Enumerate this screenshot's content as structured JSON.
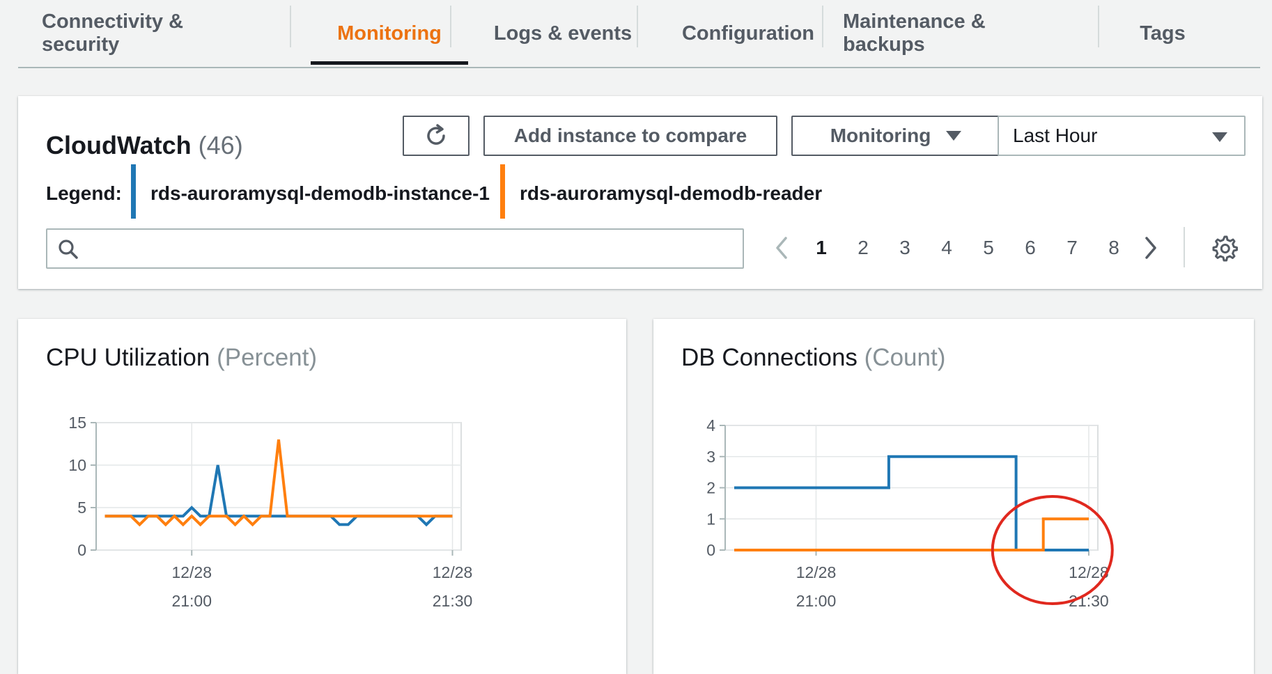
{
  "tabs": [
    {
      "label": "Connectivity & security",
      "active": false
    },
    {
      "label": "Monitoring",
      "active": true
    },
    {
      "label": "Logs & events",
      "active": false
    },
    {
      "label": "Configuration",
      "active": false
    },
    {
      "label": "Maintenance & backups",
      "active": false
    },
    {
      "label": "Tags",
      "active": false
    }
  ],
  "cloudwatch": {
    "title": "CloudWatch",
    "count": "(46)",
    "refresh_icon": "refresh-icon",
    "add_compare_label": "Add instance to compare",
    "monitoring_dropdown": "Monitoring",
    "time_range": "Last Hour",
    "legend_label": "Legend:",
    "legend": [
      {
        "name": "rds-auroramysql-demodb-instance-1",
        "color": "#1f77b4"
      },
      {
        "name": "rds-auroramysql-demodb-reader",
        "color": "#ff7f0e"
      }
    ],
    "search": {
      "value": "",
      "placeholder": ""
    },
    "pagination": {
      "pages": [
        "1",
        "2",
        "3",
        "4",
        "5",
        "6",
        "7",
        "8"
      ],
      "current": "1"
    }
  },
  "colors": {
    "accent": "#ec7211",
    "series1": "#1f77b4",
    "series2": "#ff7f0e",
    "annotation": "#e0281e"
  },
  "chart_data": [
    {
      "type": "line",
      "title": "CPU Utilization",
      "unit": "(Percent)",
      "xlabel": "",
      "ylabel": "",
      "ylim": [
        0,
        15
      ],
      "yticks": [
        "0",
        "5",
        "10",
        "15"
      ],
      "xlim": [
        "20:49",
        "21:31"
      ],
      "xticks": [
        {
          "at": "21:00",
          "date": "12/28",
          "time": "21:00"
        },
        {
          "at": "21:30",
          "date": "12/28",
          "time": "21:30"
        }
      ],
      "grid": true,
      "series": [
        {
          "name": "rds-auroramysql-demodb-instance-1",
          "color": "#1f77b4",
          "x": [
            "20:50",
            "20:51",
            "20:52",
            "20:53",
            "20:54",
            "20:55",
            "20:56",
            "20:57",
            "20:58",
            "20:59",
            "21:00",
            "21:01",
            "21:02",
            "21:03",
            "21:04",
            "21:05",
            "21:06",
            "21:07",
            "21:08",
            "21:09",
            "21:10",
            "21:11",
            "21:12",
            "21:13",
            "21:14",
            "21:15",
            "21:16",
            "21:17",
            "21:18",
            "21:19",
            "21:20",
            "21:21",
            "21:22",
            "21:23",
            "21:24",
            "21:25",
            "21:26",
            "21:27",
            "21:28",
            "21:29",
            "21:30"
          ],
          "values": [
            4,
            4,
            4,
            4,
            4,
            4,
            4,
            4,
            4,
            4,
            5,
            4,
            4,
            10,
            4,
            4,
            4,
            4,
            4,
            4,
            4,
            4,
            4,
            4,
            4,
            4,
            4,
            3,
            3,
            4,
            4,
            4,
            4,
            4,
            4,
            4,
            4,
            3,
            4,
            4,
            4
          ]
        },
        {
          "name": "rds-auroramysql-demodb-reader",
          "color": "#ff7f0e",
          "x": [
            "20:50",
            "20:51",
            "20:52",
            "20:53",
            "20:54",
            "20:55",
            "20:56",
            "20:57",
            "20:58",
            "20:59",
            "21:00",
            "21:01",
            "21:02",
            "21:03",
            "21:04",
            "21:05",
            "21:06",
            "21:07",
            "21:08",
            "21:09",
            "21:10",
            "21:11",
            "21:12",
            "21:13",
            "21:14",
            "21:15",
            "21:16",
            "21:17",
            "21:18",
            "21:19",
            "21:20",
            "21:21",
            "21:22",
            "21:23",
            "21:24",
            "21:25",
            "21:26",
            "21:27",
            "21:28",
            "21:29",
            "21:30"
          ],
          "values": [
            4,
            4,
            4,
            4,
            3,
            4,
            4,
            3,
            4,
            3,
            4,
            3,
            4,
            4,
            4,
            3,
            4,
            3,
            4,
            4,
            13,
            4,
            4,
            4,
            4,
            4,
            4,
            4,
            4,
            4,
            4,
            4,
            4,
            4,
            4,
            4,
            4,
            4,
            4,
            4,
            4
          ]
        }
      ]
    },
    {
      "type": "line",
      "title": "DB Connections",
      "unit": "(Count)",
      "xlabel": "",
      "ylabel": "",
      "ylim": [
        0,
        4
      ],
      "yticks": [
        "0",
        "1",
        "2",
        "3",
        "4"
      ],
      "xlim": [
        "20:50",
        "21:31"
      ],
      "xticks": [
        {
          "at": "21:00",
          "date": "12/28",
          "time": "21:00"
        },
        {
          "at": "21:30",
          "date": "12/28",
          "time": "21:30"
        }
      ],
      "grid": true,
      "step": true,
      "series": [
        {
          "name": "rds-auroramysql-demodb-instance-1",
          "color": "#1f77b4",
          "x": [
            "20:51",
            "21:08",
            "21:08",
            "21:22",
            "21:22",
            "21:30"
          ],
          "values": [
            2,
            2,
            3,
            3,
            0,
            0
          ]
        },
        {
          "name": "rds-auroramysql-demodb-reader",
          "color": "#ff7f0e",
          "x": [
            "20:51",
            "21:25",
            "21:25",
            "21:30"
          ],
          "values": [
            0,
            0,
            1,
            1
          ]
        }
      ],
      "annotation": {
        "shape": "ellipse",
        "color": "#e0281e",
        "around_x": "21:26",
        "around_y": 0
      }
    }
  ]
}
